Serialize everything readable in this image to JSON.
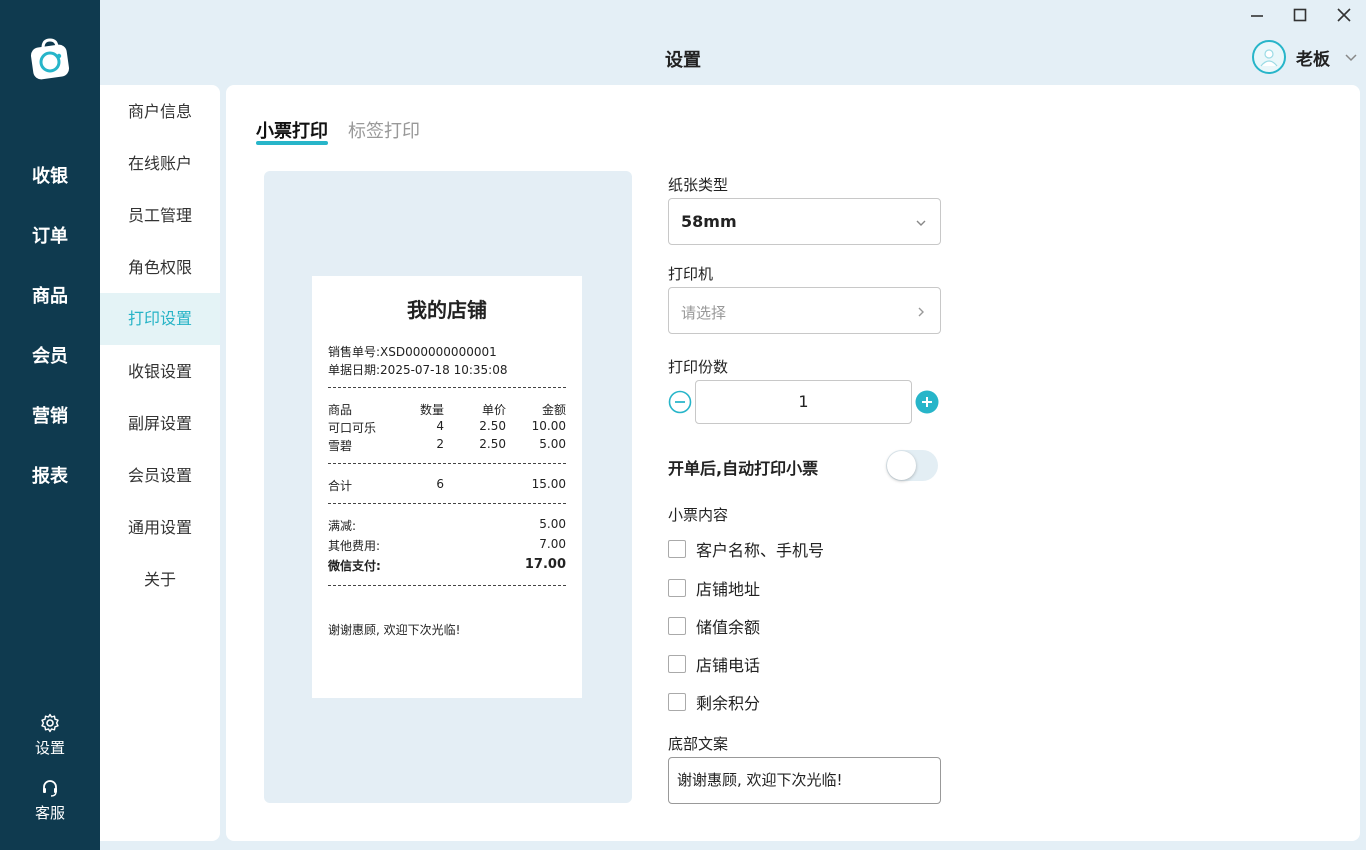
{
  "app": {
    "page_title": "设置",
    "user_name": "老板"
  },
  "leftnav": {
    "items": [
      "收银",
      "订单",
      "商品",
      "会员",
      "营销",
      "报表"
    ],
    "bottom": [
      "设置",
      "客服"
    ]
  },
  "menu": {
    "items": [
      "商户信息",
      "在线账户",
      "员工管理",
      "角色权限",
      "打印设置",
      "收银设置",
      "副屏设置",
      "会员设置",
      "通用设置",
      "关于"
    ],
    "active": "打印设置"
  },
  "tabs": [
    "小票打印",
    "标签打印"
  ],
  "receipt": {
    "shop_name": "我的店铺",
    "order_no": "销售单号:XSD000000000001",
    "order_date": "单据日期:2025-07-18 10:35:08",
    "headers": [
      "商品",
      "数量",
      "单价",
      "金额"
    ],
    "items": [
      [
        "可口可乐",
        "4",
        "2.50",
        "10.00"
      ],
      [
        "雪碧",
        "2",
        "2.50",
        "5.00"
      ]
    ],
    "total_label": "合计",
    "total_qty": "6",
    "total_amount": "15.00",
    "discount_label": "满减:",
    "discount_value": "5.00",
    "other_label": "其他费用:",
    "other_value": "7.00",
    "pay_label": "微信支付:",
    "pay_value": "17.00",
    "footer": "谢谢惠顾, 欢迎下次光临!"
  },
  "form": {
    "paper_label": "纸张类型",
    "paper_value": "58mm",
    "printer_label": "打印机",
    "printer_placeholder": "请选择",
    "copies_label": "打印份数",
    "copies_value": "1",
    "auto_print_label": "开单后,自动打印小票",
    "auto_print_on": false,
    "content_label": "小票内容",
    "content_options": [
      "客户名称、手机号",
      "店铺地址",
      "储值余额",
      "店铺电话",
      "剩余积分"
    ],
    "footer_label": "底部文案",
    "footer_value": "谢谢惠顾, 欢迎下次光临!"
  },
  "colors": {
    "nav_bg": "#0f3a4f",
    "accent": "#27b5c9",
    "page_bg": "#e4eff6"
  }
}
